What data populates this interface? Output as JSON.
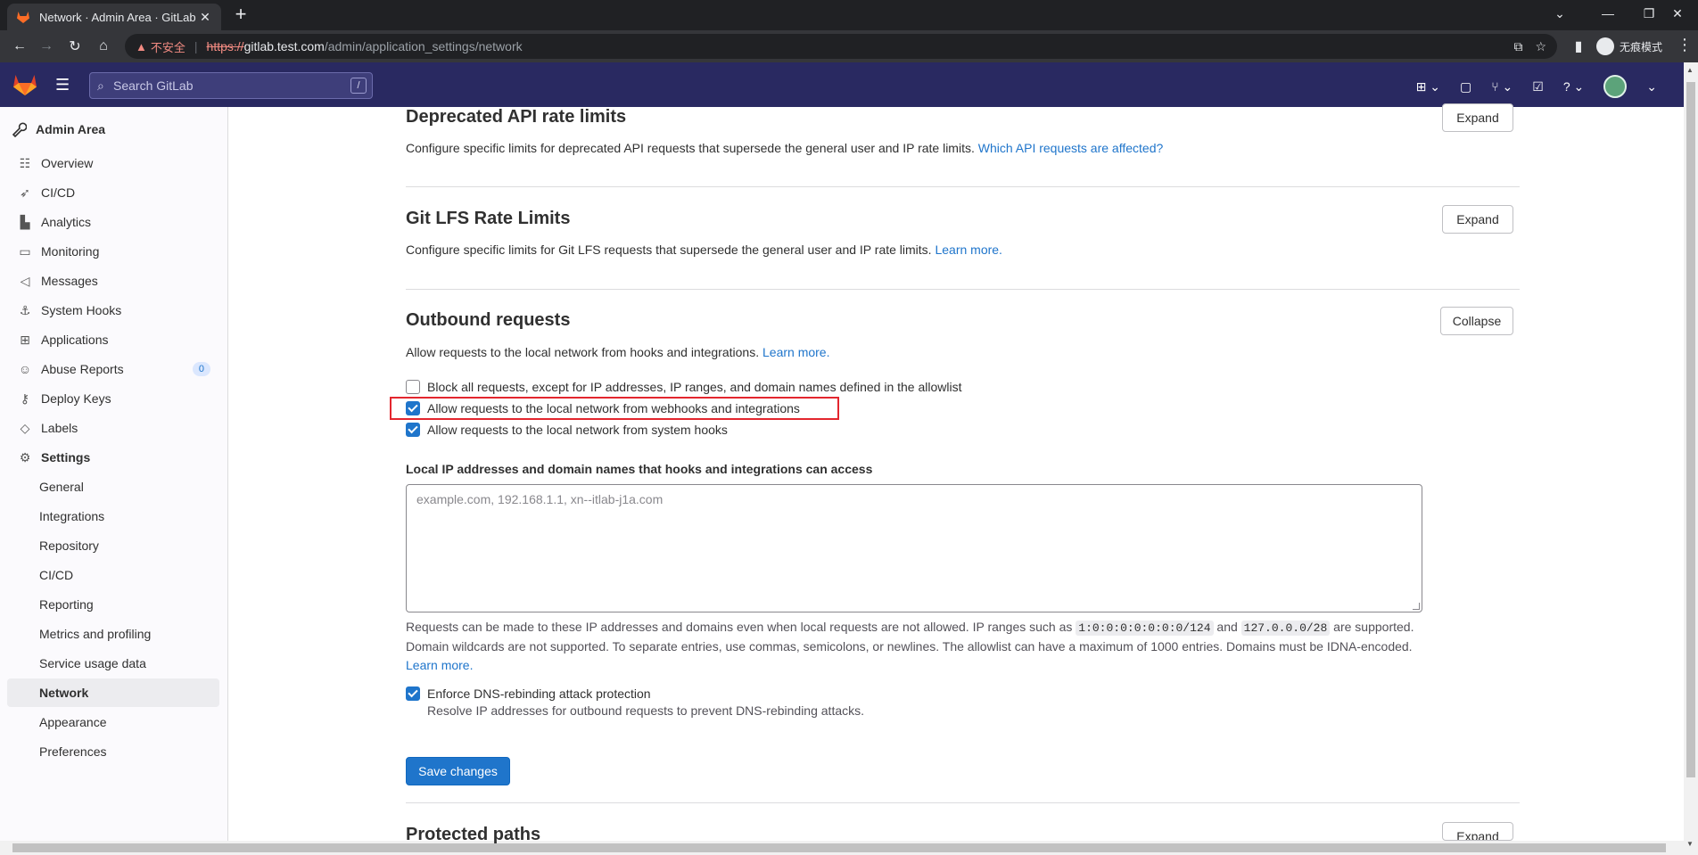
{
  "browser": {
    "tab_title": "Network · Admin Area · GitLab",
    "tab_close": "✕",
    "new_tab": "+",
    "insecure_label": "不安全",
    "url_scheme": "https://",
    "url_host": "gitlab.test.com",
    "url_path": "/admin/application_settings/network",
    "profile_label": "无痕模式"
  },
  "topnav": {
    "search_placeholder": "Search GitLab",
    "search_shortcut": "/"
  },
  "sidebar": {
    "header": "Admin Area",
    "items": [
      {
        "label": "Overview"
      },
      {
        "label": "CI/CD"
      },
      {
        "label": "Analytics"
      },
      {
        "label": "Monitoring"
      },
      {
        "label": "Messages"
      },
      {
        "label": "System Hooks"
      },
      {
        "label": "Applications"
      },
      {
        "label": "Abuse Reports",
        "badge": "0"
      },
      {
        "label": "Deploy Keys"
      },
      {
        "label": "Labels"
      },
      {
        "label": "Settings"
      }
    ],
    "settings_sub": [
      {
        "label": "General"
      },
      {
        "label": "Integrations"
      },
      {
        "label": "Repository"
      },
      {
        "label": "CI/CD"
      },
      {
        "label": "Reporting"
      },
      {
        "label": "Metrics and profiling"
      },
      {
        "label": "Service usage data"
      },
      {
        "label": "Network"
      },
      {
        "label": "Appearance"
      },
      {
        "label": "Preferences"
      }
    ]
  },
  "sections": {
    "deprecated": {
      "title": "Deprecated API rate limits",
      "desc": "Configure specific limits for deprecated API requests that supersede the general user and IP rate limits.",
      "link": "Which API requests are affected?",
      "button": "Expand"
    },
    "lfs": {
      "title": "Git LFS Rate Limits",
      "desc": "Configure specific limits for Git LFS requests that supersede the general user and IP rate limits.",
      "link": "Learn more.",
      "button": "Expand"
    },
    "outbound": {
      "title": "Outbound requests",
      "desc": "Allow requests to the local network from hooks and integrations.",
      "link": "Learn more.",
      "button": "Collapse",
      "checkboxes": [
        {
          "label": "Block all requests, except for IP addresses, IP ranges, and domain names defined in the allowlist",
          "checked": false
        },
        {
          "label": "Allow requests to the local network from webhooks and integrations",
          "checked": true
        },
        {
          "label": "Allow requests to the local network from system hooks",
          "checked": true
        }
      ],
      "allowlist_label": "Local IP addresses and domain names that hooks and integrations can access",
      "allowlist_placeholder": "example.com, 192.168.1.1, xn--itlab-j1a.com",
      "help_1": "Requests can be made to these IP addresses and domains even when local requests are not allowed. IP ranges such as",
      "help_code1": "1:0:0:0:0:0:0:0/124",
      "help_and": "and",
      "help_code2": "127.0.0.0/28",
      "help_2": "are supported. Domain wildcards are not supported. To separate entries, use commas, semicolons, or newlines. The allowlist can have a maximum of 1000 entries. Domains must be IDNA-encoded.",
      "help_link": "Learn more.",
      "dns_label": "Enforce DNS-rebinding attack protection",
      "dns_help": "Resolve IP addresses for outbound requests to prevent DNS-rebinding attacks.",
      "save": "Save changes"
    },
    "protected": {
      "title": "Protected paths",
      "button": "Expand"
    }
  },
  "colors": {
    "nav_bg": "#292961",
    "primary": "#1f75cb",
    "highlight": "#e3262e"
  }
}
